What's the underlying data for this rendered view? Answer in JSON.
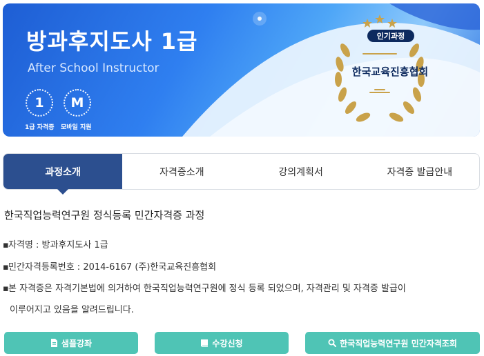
{
  "banner": {
    "title": "방과후지도사 1급",
    "subtitle": "After School Instructor",
    "badges": [
      {
        "symbol": "1",
        "caption": "1급 자격증"
      },
      {
        "symbol": "M",
        "caption": "모바일 지원"
      }
    ],
    "popular_label": "인기과정",
    "org_name": "한국교육진흥협회"
  },
  "tabs": [
    {
      "label": "과정소개",
      "active": true
    },
    {
      "label": "자격증소개",
      "active": false
    },
    {
      "label": "강의계획서",
      "active": false
    },
    {
      "label": "자격증 발급안내",
      "active": false
    }
  ],
  "content": {
    "title": "한국직업능력연구원 정식등록 민간자격증 과정",
    "bullet": "▪",
    "items": [
      "자격명 : 방과후지도사 1급",
      "민간자격등록번호 : 2014-6167 (주)한국교육진흥협회",
      "본 자격증은 자격기본법에 의거하여 한국직업능력연구원에 정식 등록 되었으며, 자격관리 및 자격증 발급이"
    ],
    "item_continuation": "이루어지고 있음을 알려드립니다."
  },
  "buttons": [
    {
      "label": "샘플강좌",
      "icon": "document-icon"
    },
    {
      "label": "수강신청",
      "icon": "book-icon"
    },
    {
      "label": "한국직업능력연구원 민간자격조회",
      "icon": "search-icon"
    }
  ],
  "colors": {
    "tab_active": "#2c4f8f",
    "button": "#4fc4b5",
    "badge_navy": "#0d2a5e",
    "wreath_gold": "#c9a24a"
  }
}
